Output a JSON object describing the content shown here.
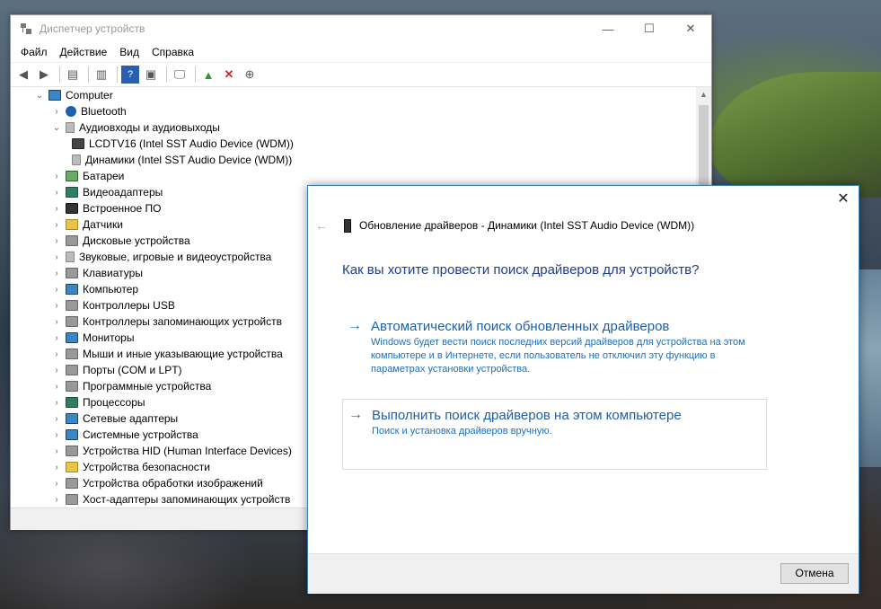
{
  "device_manager": {
    "title": "Диспетчер устройств",
    "window_controls": {
      "minimize": "—",
      "maximize": "☐",
      "close": "✕"
    },
    "menu": [
      "Файл",
      "Действие",
      "Вид",
      "Справка"
    ],
    "tree": [
      {
        "label": "Computer",
        "level": 0,
        "chev": "⌄",
        "icon": "mon"
      },
      {
        "label": "Bluetooth",
        "level": 1,
        "chev": "›",
        "icon": "bt"
      },
      {
        "label": "Аудиовходы и аудиовыходы",
        "level": 1,
        "chev": "⌄",
        "icon": "spk"
      },
      {
        "label": "LCDTV16 (Intel SST Audio Device (WDM))",
        "level": 2,
        "chev": "",
        "icon": "tv"
      },
      {
        "label": "Динамики (Intel SST Audio Device (WDM))",
        "level": 2,
        "chev": "",
        "icon": "spk"
      },
      {
        "label": "Батареи",
        "level": 1,
        "chev": "›",
        "icon": "bat"
      },
      {
        "label": "Видеоадаптеры",
        "level": 1,
        "chev": "›",
        "icon": "gpu"
      },
      {
        "label": "Встроенное ПО",
        "level": 1,
        "chev": "›",
        "icon": "chip"
      },
      {
        "label": "Датчики",
        "level": 1,
        "chev": "›",
        "icon": "yel"
      },
      {
        "label": "Дисковые устройства",
        "level": 1,
        "chev": "›",
        "icon": "gray"
      },
      {
        "label": "Звуковые, игровые и видеоустройства",
        "level": 1,
        "chev": "›",
        "icon": "spk"
      },
      {
        "label": "Клавиатуры",
        "level": 1,
        "chev": "›",
        "icon": "gray"
      },
      {
        "label": "Компьютер",
        "level": 1,
        "chev": "›",
        "icon": "mon"
      },
      {
        "label": "Контроллеры USB",
        "level": 1,
        "chev": "›",
        "icon": "gray"
      },
      {
        "label": "Контроллеры запоминающих устройств",
        "level": 1,
        "chev": "›",
        "icon": "gray"
      },
      {
        "label": "Мониторы",
        "level": 1,
        "chev": "›",
        "icon": "mon"
      },
      {
        "label": "Мыши и иные указывающие устройства",
        "level": 1,
        "chev": "›",
        "icon": "gray"
      },
      {
        "label": "Порты (COM и LPT)",
        "level": 1,
        "chev": "›",
        "icon": "gray"
      },
      {
        "label": "Программные устройства",
        "level": 1,
        "chev": "›",
        "icon": "gray"
      },
      {
        "label": "Процессоры",
        "level": 1,
        "chev": "›",
        "icon": "gpu"
      },
      {
        "label": "Сетевые адаптеры",
        "level": 1,
        "chev": "›",
        "icon": "mon"
      },
      {
        "label": "Системные устройства",
        "level": 1,
        "chev": "›",
        "icon": "mon"
      },
      {
        "label": "Устройства HID (Human Interface Devices)",
        "level": 1,
        "chev": "›",
        "icon": "gray"
      },
      {
        "label": "Устройства безопасности",
        "level": 1,
        "chev": "›",
        "icon": "yel"
      },
      {
        "label": "Устройства обработки изображений",
        "level": 1,
        "chev": "›",
        "icon": "gray"
      },
      {
        "label": "Хост-адаптеры запоминающих устройств",
        "level": 1,
        "chev": "›",
        "icon": "gray"
      }
    ]
  },
  "dialog": {
    "close": "✕",
    "back": "←",
    "title": "Обновление драйверов - Динамики (Intel SST Audio Device (WDM))",
    "question": "Как вы хотите провести поиск драйверов для устройств?",
    "arrow": "→",
    "option_auto": {
      "title": "Автоматический поиск обновленных драйверов",
      "desc": "Windows будет вести поиск последних версий драйверов для устройства на этом компьютере и в Интернете, если пользователь не отключил эту функцию в параметрах установки устройства."
    },
    "option_manual": {
      "title": "Выполнить поиск драйверов на этом компьютере",
      "desc": "Поиск и установка драйверов вручную."
    },
    "cancel": "Отмена"
  }
}
